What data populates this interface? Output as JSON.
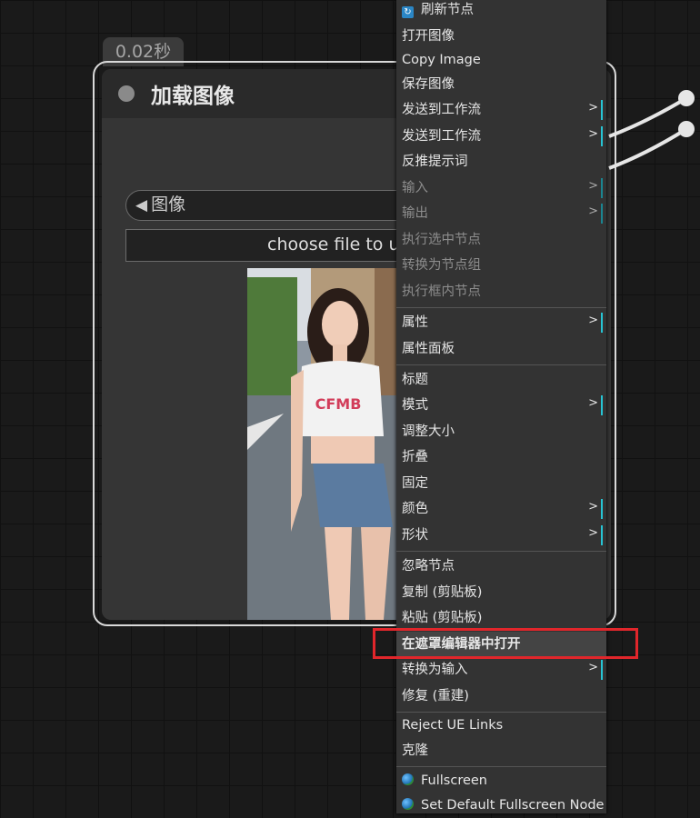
{
  "node": {
    "time": "0.02秒",
    "title": "加载图像",
    "image_combo": "图像",
    "upload_label": "choose file to u"
  },
  "context_menu": {
    "items": [
      {
        "label": "刷新节点",
        "icon": "refresh-icon"
      },
      {
        "label": "打开图像"
      },
      {
        "label": "Copy Image"
      },
      {
        "label": "保存图像"
      },
      {
        "label": "发送到工作流",
        "submenu": true
      },
      {
        "label": "发送到工作流",
        "submenu": true
      },
      {
        "label": "反推提示词"
      },
      {
        "label": "输入",
        "submenu": true,
        "disabled": true
      },
      {
        "label": "输出",
        "submenu": true,
        "disabled": true
      },
      {
        "label": "执行选中节点",
        "disabled": true
      },
      {
        "label": "转换为节点组",
        "disabled": true
      },
      {
        "label": "执行框内节点",
        "disabled": true
      },
      {
        "label": "属性",
        "submenu": true
      },
      {
        "label": "属性面板"
      },
      {
        "label": "标题"
      },
      {
        "label": "模式",
        "submenu": true
      },
      {
        "label": "调整大小"
      },
      {
        "label": "折叠"
      },
      {
        "label": "固定"
      },
      {
        "label": "颜色",
        "submenu": true
      },
      {
        "label": "形状",
        "submenu": true
      },
      {
        "label": "忽略节点"
      },
      {
        "label": "复制 (剪贴板)"
      },
      {
        "label": "粘贴 (剪贴板)"
      },
      {
        "label": "在遮罩编辑器中打开",
        "highlighted": true
      },
      {
        "label": "转换为输入",
        "submenu": true
      },
      {
        "label": "修复 (重建)"
      },
      {
        "label": "Reject UE Links"
      },
      {
        "label": "克隆"
      },
      {
        "label": "Fullscreen",
        "icon": "globe-icon"
      },
      {
        "label": "Set Default Fullscreen Node",
        "icon": "globe-icon"
      }
    ],
    "submenu_arrow": ">"
  },
  "colors": {
    "highlight_box": "#e1262b",
    "submenu_marker": "#27c4d4",
    "canvas_bg": "#1a1a1a",
    "menu_bg": "#333333"
  }
}
